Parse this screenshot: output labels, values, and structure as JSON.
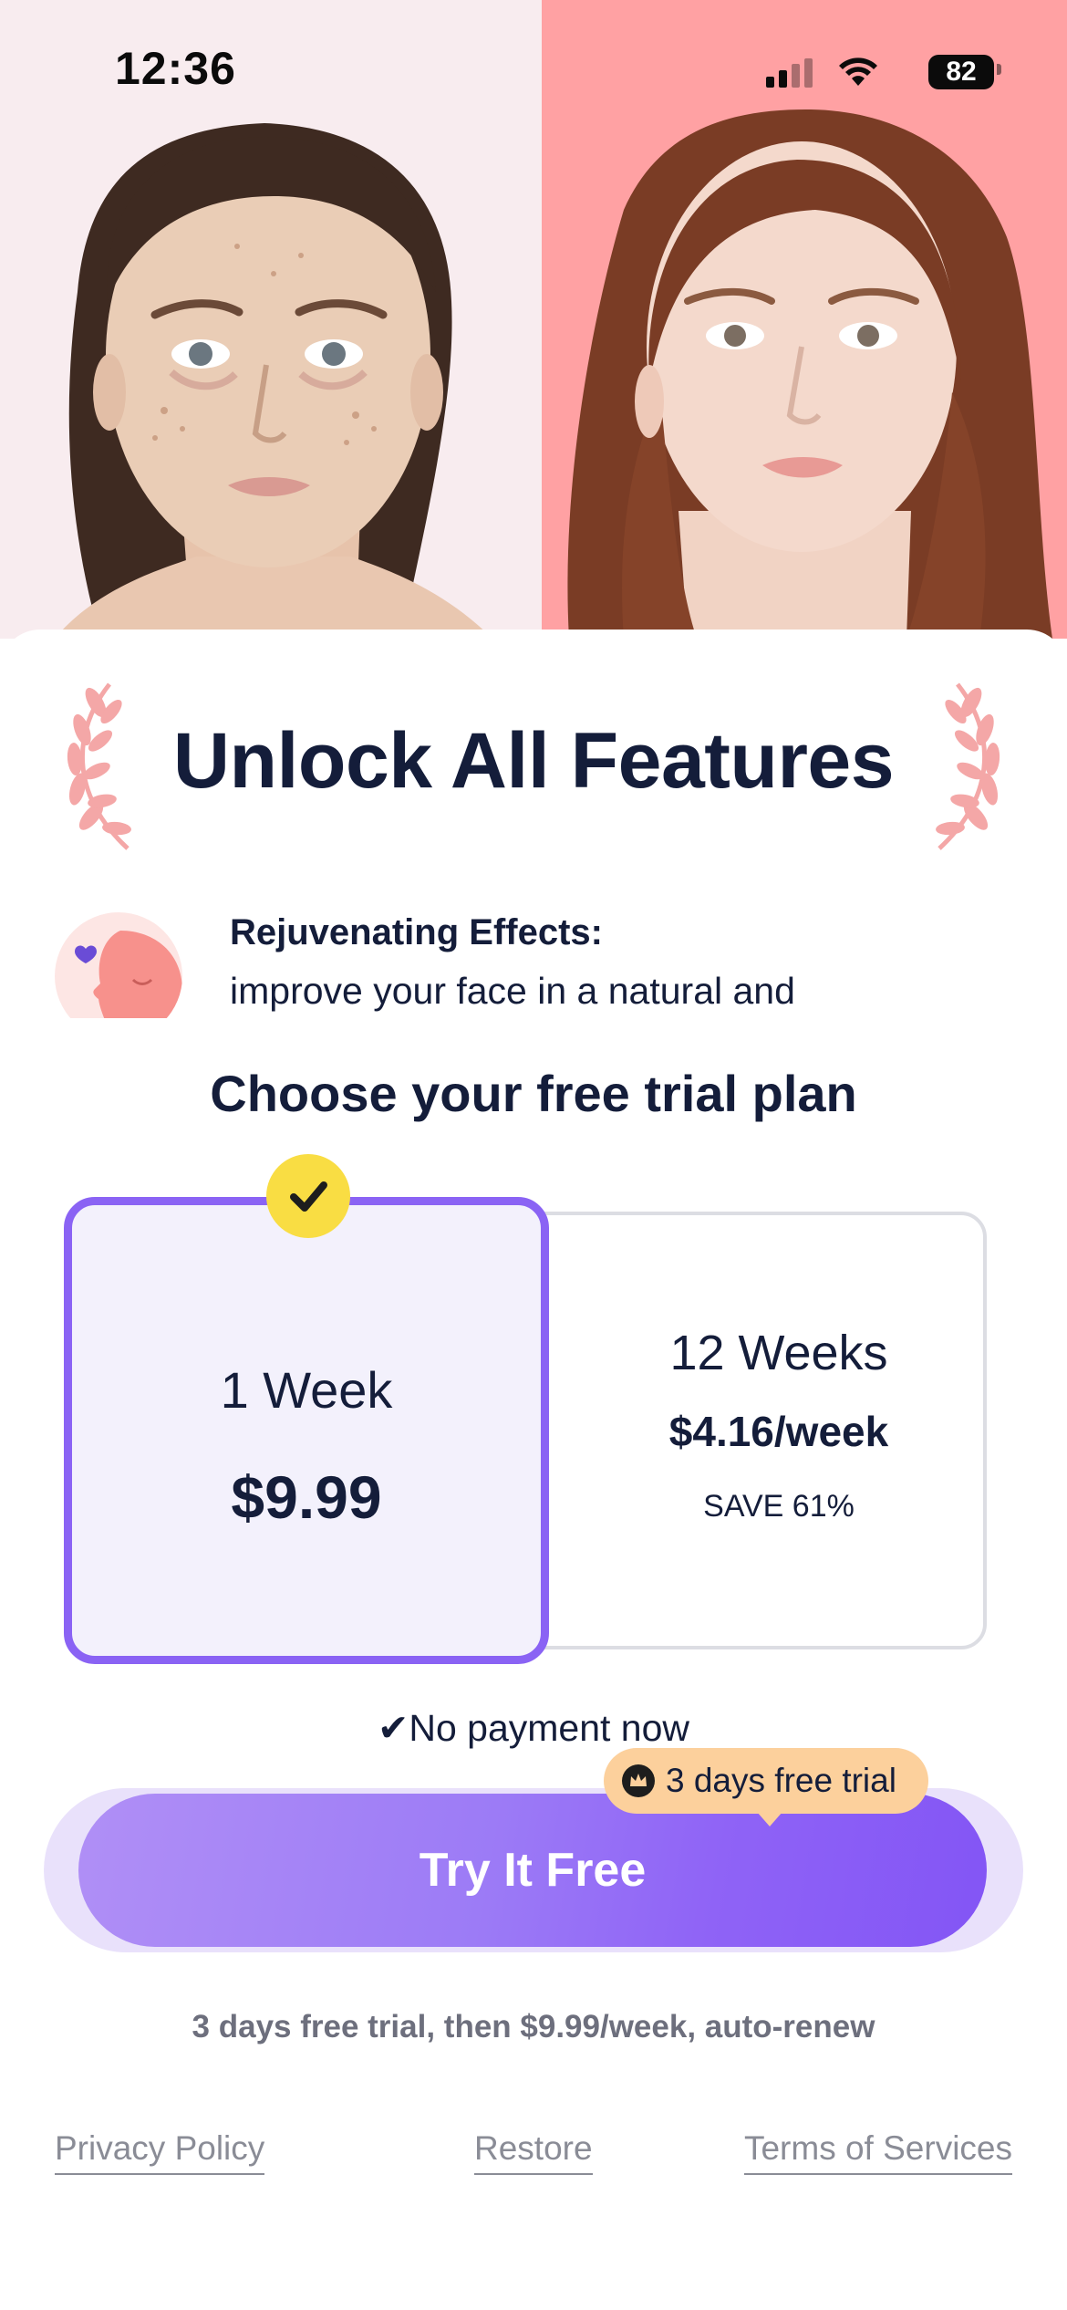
{
  "status_bar": {
    "time": "12:36",
    "battery": "82",
    "icons": [
      "cellular-signal-icon",
      "wifi-icon",
      "battery-icon"
    ]
  },
  "hero": {
    "images": [
      "before-portrait",
      "after-portrait"
    ],
    "colors": {
      "left_bg": "#f8ecef",
      "right_bg": "#ffa1a3"
    }
  },
  "paywall": {
    "title": "Unlock All Features",
    "feature": {
      "title": "Rejuvenating Effects:",
      "description": "improve your face in a natural and healthy way"
    },
    "plan_heading": "Choose your free trial plan",
    "plans": [
      {
        "name": "1 Week",
        "price": "$9.99",
        "selected": true
      },
      {
        "name": "12 Weeks",
        "price": "$4.16/week",
        "save": "SAVE 61%",
        "selected": false
      }
    ],
    "no_payment": "✔No payment now",
    "trial_badge": "3 days free trial",
    "cta_label": "Try It Free",
    "terms": "3 days free trial, then $9.99/week, auto-renew"
  },
  "footer": {
    "privacy": "Privacy Policy",
    "restore": "Restore",
    "terms": "Terms of Services"
  },
  "colors": {
    "accent": "#8a63f4",
    "check_badge": "#f9dd43",
    "trial_pill": "#fcd09c",
    "text_dark": "#141d3a"
  }
}
